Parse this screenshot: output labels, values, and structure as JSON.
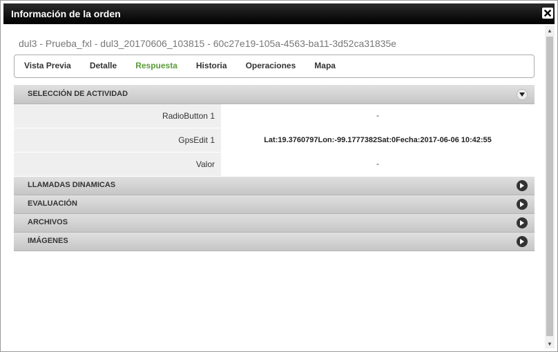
{
  "window": {
    "title": "Información de la orden",
    "close_icon": "close-icon"
  },
  "order_id": "dul3 - Prueba_fxl - dul3_20170606_103815 - 60c27e19-105a-4563-ba11-3d52ca31835e",
  "tabs": [
    {
      "label": "Vista Previa",
      "active": false
    },
    {
      "label": "Detalle",
      "active": false
    },
    {
      "label": "Respuesta",
      "active": true
    },
    {
      "label": "Historia",
      "active": false
    },
    {
      "label": "Operaciones",
      "active": false
    },
    {
      "label": "Mapa",
      "active": false
    }
  ],
  "sections": {
    "actividad": {
      "title": "SELECCIÓN DE ACTIVIDAD",
      "expanded": true,
      "rows": [
        {
          "label": "RadioButton 1",
          "value": "-"
        },
        {
          "label": "GpsEdit 1",
          "value": "Lat:19.3760797Lon:-99.1777382Sat:0Fecha:2017-06-06 10:42:55"
        },
        {
          "label": "Valor",
          "value": "-"
        }
      ]
    },
    "llamadas": {
      "title": "LLAMADAS DINAMICAS",
      "expanded": false
    },
    "evaluacion": {
      "title": "EVALUACIÓN",
      "expanded": false
    },
    "archivos": {
      "title": "ARCHIVOS",
      "expanded": false
    },
    "imagenes": {
      "title": "IMÁGENES",
      "expanded": false
    }
  },
  "colors": {
    "titlebar": "#000000",
    "active_tab": "#5a9a3a",
    "section_header": "#d0d0d0"
  }
}
